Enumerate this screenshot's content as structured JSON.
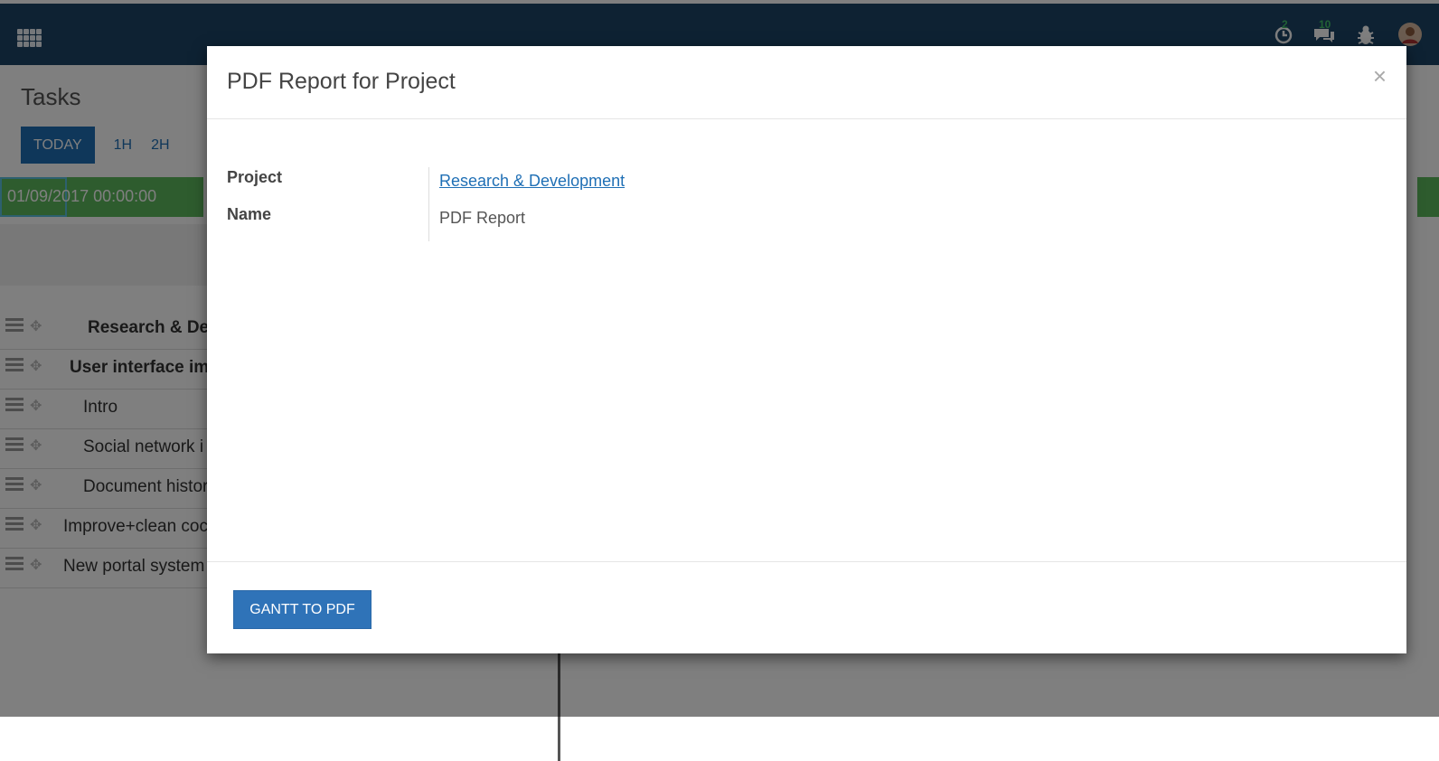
{
  "navbar": {
    "activity_badge": "2",
    "messages_badge": "10"
  },
  "page": {
    "title": "Tasks",
    "scale": [
      "TODAY",
      "1H",
      "2H"
    ],
    "date": "01/09/2017 00:00:00"
  },
  "tasks": [
    {
      "label": "Research & De",
      "bold": true,
      "indent": 97
    },
    {
      "label": "User interface im",
      "bold": true,
      "indent": 77
    },
    {
      "label": "Intro",
      "bold": false,
      "indent": 92
    },
    {
      "label": "Social network i",
      "bold": false,
      "indent": 92
    },
    {
      "label": "Document histor",
      "bold": false,
      "indent": 92
    },
    {
      "label": "Improve+clean coc",
      "bold": false,
      "indent": 70
    },
    {
      "label": "New portal system",
      "bold": false,
      "indent": 70
    }
  ],
  "modal": {
    "title": "PDF Report for Project",
    "close": "×",
    "fields": [
      {
        "label": "Project",
        "value": "Research & Development"
      },
      {
        "label": "Name",
        "value": "PDF Report"
      }
    ],
    "button": "GANTT TO PDF"
  },
  "colors": {
    "navbar": "#1c4566",
    "primary": "#2f73b8",
    "green": "#5cb85c",
    "badge": "#43c16a"
  }
}
